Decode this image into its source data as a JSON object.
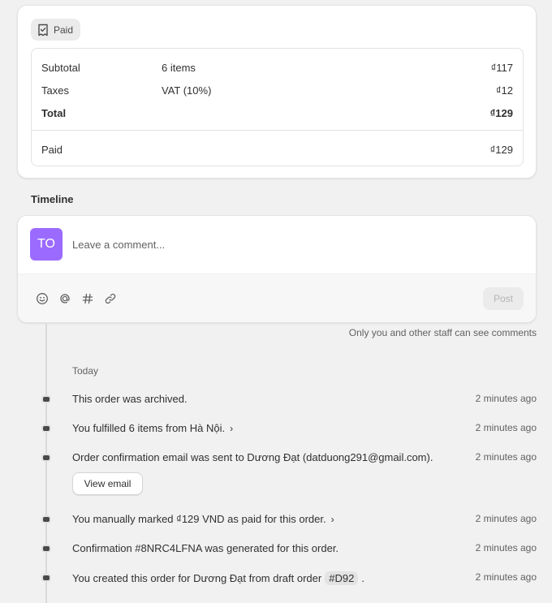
{
  "payment": {
    "badge": "Paid",
    "rows": [
      {
        "label": "Subtotal",
        "detail": "6 items",
        "amount": "₫117"
      },
      {
        "label": "Taxes",
        "detail": "VAT (10%)",
        "amount": "₫12"
      },
      {
        "label": "Total",
        "detail": "",
        "amount": "₫129"
      }
    ],
    "paid": {
      "label": "Paid",
      "amount": "₫129"
    }
  },
  "timeline": {
    "title": "Timeline",
    "avatar_initials": "TO",
    "avatar_color": "#9b6bff",
    "comment_placeholder": "Leave a comment...",
    "tools": [
      "emoji-icon",
      "mention-icon",
      "hashtag-icon",
      "link-icon"
    ],
    "post_label": "Post",
    "staff_note": "Only you and other staff can see comments",
    "day": "Today",
    "events": [
      {
        "text": "This order was archived.",
        "time": "2 minutes ago"
      },
      {
        "text": "You fulfilled 6 items from Hà Nội.",
        "time": "2 minutes ago"
      },
      {
        "text": "Order confirmation email was sent to Dương Đạt (datduong291@gmail.com).",
        "time": "2 minutes ago",
        "button": "View email"
      },
      {
        "text": "You manually marked ₫129 VND as paid for this order.",
        "time": "2 minutes ago"
      },
      {
        "text": "Confirmation #8NRC4LFNA was generated for this order.",
        "time": "2 minutes ago"
      },
      {
        "text_prefix": "You created this order for Dương Đạt from draft order",
        "tag": "#D92",
        "text_suffix": ".",
        "time": "2 minutes ago"
      }
    ]
  }
}
